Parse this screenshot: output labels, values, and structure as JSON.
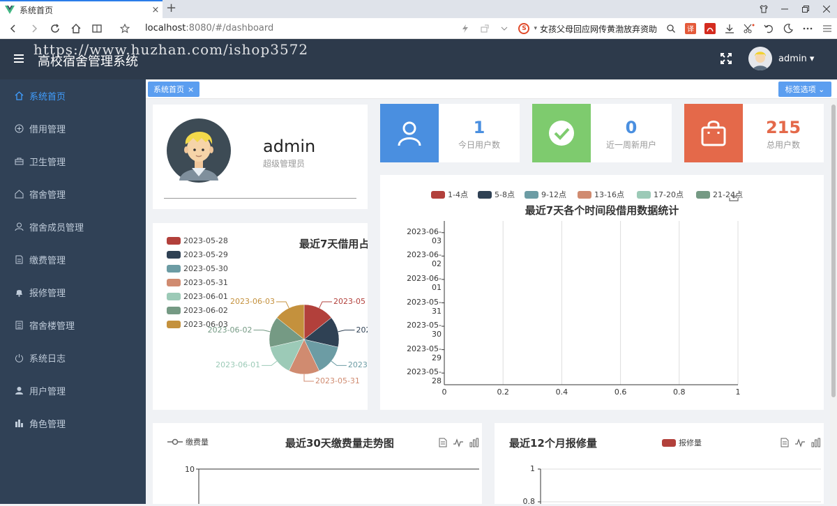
{
  "browser": {
    "tab_title": "系统首页",
    "tab_close": "×",
    "new_tab": "+",
    "url_host": "localhost",
    "url_rest": ":8080/#/dashboard",
    "search_text": "女孩父母回应网传黄渤放弃资助",
    "search_logo": "S"
  },
  "header": {
    "watermark": "https://www.huzhan.com/ishop3572",
    "title": "高校宿舍管理系统",
    "username": "admin ▾"
  },
  "sidebar": {
    "items": [
      {
        "label": "系统首页",
        "icon": "home-icon"
      },
      {
        "label": "借用管理",
        "icon": "plus-circle-icon"
      },
      {
        "label": "卫生管理",
        "icon": "toolbox-icon"
      },
      {
        "label": "宿舍管理",
        "icon": "house-icon"
      },
      {
        "label": "宿舍成员管理",
        "icon": "person-icon"
      },
      {
        "label": "缴费管理",
        "icon": "document-icon"
      },
      {
        "label": "报修管理",
        "icon": "bell-icon"
      },
      {
        "label": "宿舍楼管理",
        "icon": "building-icon"
      },
      {
        "label": "系统日志",
        "icon": "power-icon"
      },
      {
        "label": "用户管理",
        "icon": "user-icon"
      },
      {
        "label": "角色管理",
        "icon": "bar-chart-icon"
      }
    ]
  },
  "tags": {
    "active_tag": "系统首页",
    "close": "×",
    "options_label": "标签选项 ⌄"
  },
  "profile": {
    "name": "admin",
    "role": "超级管理员"
  },
  "stats": [
    {
      "value": "1",
      "label": "今日用户数",
      "color": "#4a8fe0",
      "num_color": "#4a8fe0",
      "icon": "user-icon"
    },
    {
      "value": "0",
      "label": "近一周新用户",
      "color": "#7ecb6e",
      "num_color": "#4a8fe0",
      "icon": "check-circle-icon"
    },
    {
      "value": "215",
      "label": "总用户数",
      "color": "#e4694a",
      "num_color": "#e4694a",
      "icon": "shopping-bag-icon"
    }
  ],
  "colors": {
    "sidebar_bg": "#304156",
    "header_bg": "#2d3a4b",
    "accent": "#409eff",
    "series": [
      "#b2403b",
      "#2f4154",
      "#6c9ca4",
      "#d08b70",
      "#9ccab7",
      "#759a84",
      "#c4913d"
    ]
  },
  "chart_data": [
    {
      "type": "pie",
      "title": "最近7天借用占",
      "categories": [
        "2023-05-28",
        "2023-05-29",
        "2023-05-30",
        "2023-05-31",
        "2023-06-01",
        "2023-06-02",
        "2023-06-03"
      ],
      "values": [
        1,
        1,
        1,
        1,
        1,
        1,
        1
      ],
      "slice_labels": [
        "2023-05",
        "202",
        "2023-",
        "2023-05-31",
        "2023-06-01",
        "2023-06-02",
        "2023-06-03"
      ],
      "legend": "left"
    },
    {
      "type": "bar",
      "orientation": "horizontal",
      "title": "最近7天各个时间段借用数据统计",
      "series": [
        {
          "name": "1-4点",
          "values": [
            0,
            0,
            0,
            0,
            0,
            0,
            0
          ]
        },
        {
          "name": "5-8点",
          "values": [
            0,
            0,
            0,
            0,
            0,
            0,
            0
          ]
        },
        {
          "name": "9-12点",
          "values": [
            0,
            0,
            0,
            0,
            0,
            0,
            0
          ]
        },
        {
          "name": "13-16点",
          "values": [
            0,
            0,
            0,
            0,
            0,
            0,
            0
          ]
        },
        {
          "name": "17-20点",
          "values": [
            0,
            0,
            0,
            0,
            0,
            0,
            0
          ]
        },
        {
          "name": "21-24点",
          "values": [
            0,
            0,
            0,
            0,
            0,
            0,
            0
          ]
        }
      ],
      "categories": [
        "2023-05-28",
        "2023-05-29",
        "2023-05-30",
        "2023-05-31",
        "2023-06-01",
        "2023-06-02",
        "2023-06-03"
      ],
      "category_tick_labels": [
        "2023-05-28",
        "2023-05-29",
        "2023-05-30",
        "2023-05-31",
        "2023-06-01",
        "2023-06-02",
        "2023-06-03"
      ],
      "xticks": [
        "0",
        "0.2",
        "0.4",
        "0.6",
        "0.8",
        "1"
      ],
      "xlim": [
        0,
        1
      ],
      "grid": true,
      "legend": "top"
    },
    {
      "type": "line",
      "title": "最近30天缴费量走势图",
      "series": [
        {
          "name": "缴费量",
          "values": []
        }
      ],
      "yticks": [
        "10"
      ],
      "legend": "top-left"
    },
    {
      "type": "bar",
      "title": "最近12个月报修量",
      "series": [
        {
          "name": "报修量",
          "values": []
        }
      ],
      "yticks": [
        "1",
        "0.8"
      ],
      "legend": "top"
    }
  ]
}
